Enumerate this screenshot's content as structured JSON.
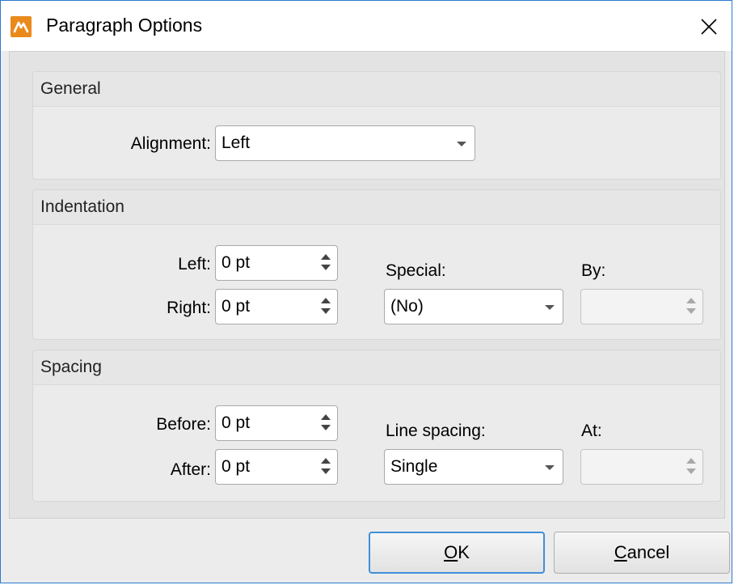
{
  "window": {
    "title": "Paragraph Options",
    "icon": "pdf-editor-app-icon",
    "close_icon": "close-icon"
  },
  "general": {
    "title": "General",
    "alignment_label": "Alignment:",
    "alignment_value": "Left"
  },
  "indentation": {
    "title": "Indentation",
    "left_label": "Left:",
    "left_value": "0 pt",
    "right_label": "Right:",
    "right_value": "0 pt",
    "special_label": "Special:",
    "special_value": "(No)",
    "by_label": "By:",
    "by_value": ""
  },
  "spacing": {
    "title": "Spacing",
    "before_label": "Before:",
    "before_value": "0 pt",
    "after_label": "After:",
    "after_value": "0 pt",
    "line_spacing_label": "Line spacing:",
    "line_spacing_value": "Single",
    "at_label": "At:",
    "at_value": ""
  },
  "buttons": {
    "ok_mnemonic": "O",
    "ok_rest": "K",
    "cancel_mnemonic": "C",
    "cancel_rest": "ancel"
  },
  "colors": {
    "app_icon": "#e98a1b",
    "window_border": "#2b79d0",
    "default_button_border": "#3f8fd8"
  }
}
